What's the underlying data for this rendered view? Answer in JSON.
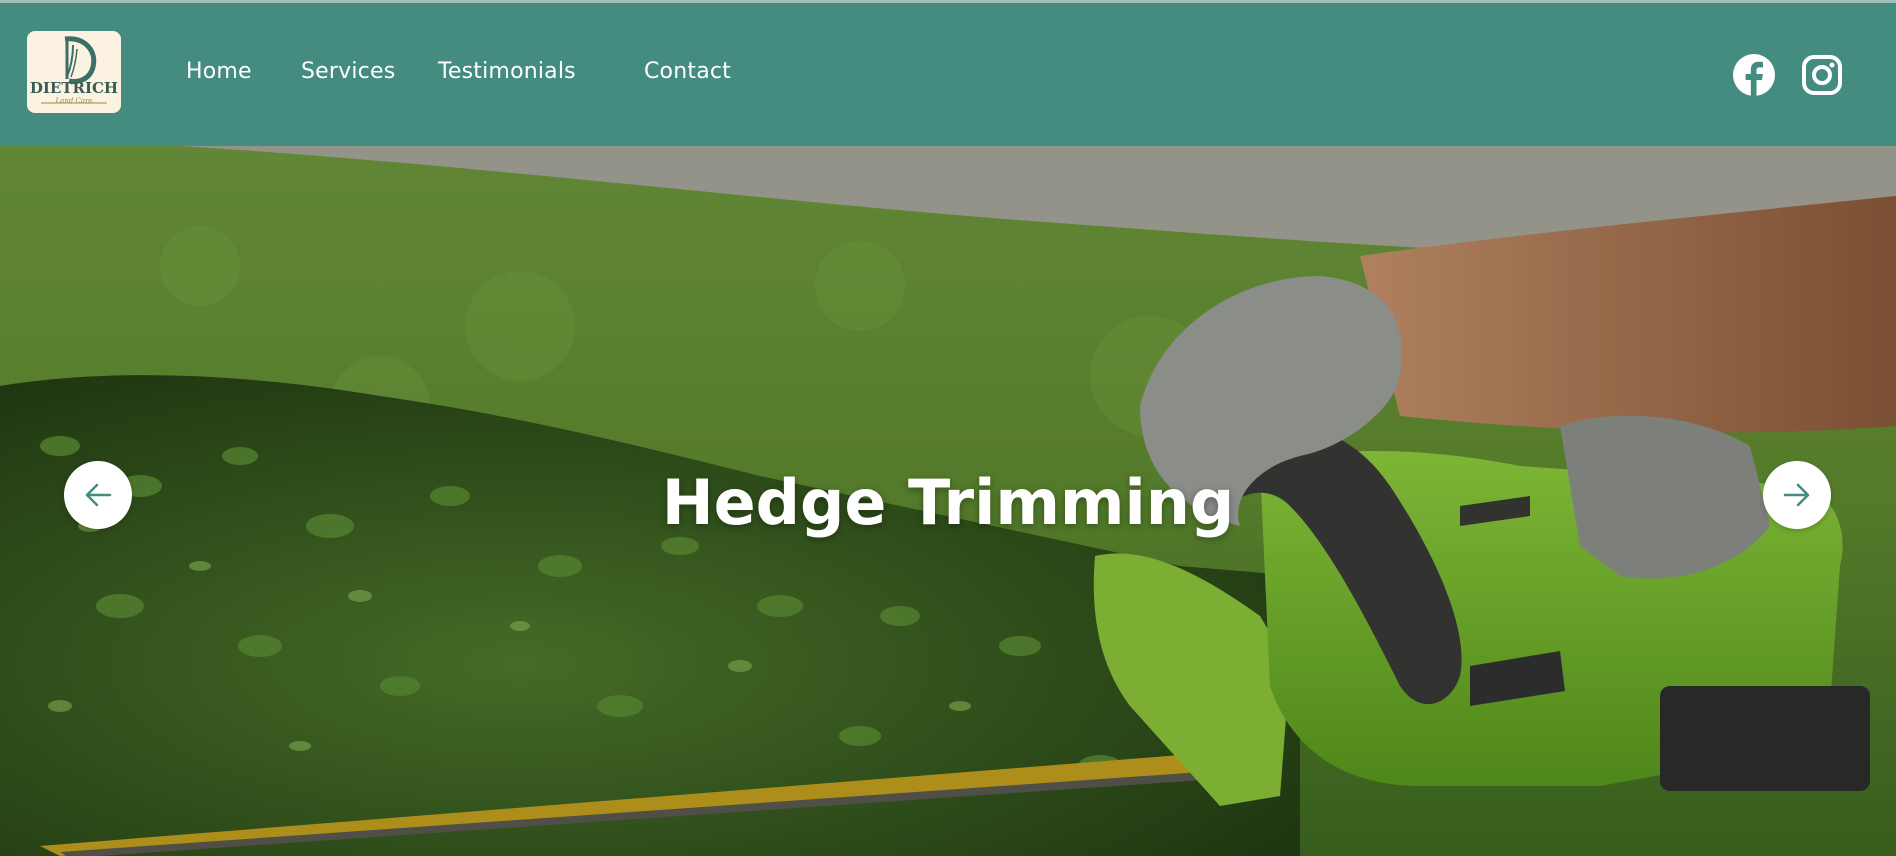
{
  "header": {
    "logo": {
      "name": "DIETRICH",
      "tagline": "Land Care"
    },
    "nav": [
      {
        "label": "Home"
      },
      {
        "label": "Services"
      },
      {
        "label": "Testimonials"
      },
      {
        "label": "Contact"
      }
    ],
    "social": [
      {
        "icon": "facebook-icon"
      },
      {
        "icon": "instagram-icon"
      }
    ],
    "colors": {
      "bar": "#458c80",
      "text": "#ffffff"
    }
  },
  "hero": {
    "title": "Hedge Trimming",
    "prev_icon": "arrow-left-icon",
    "next_icon": "arrow-right-icon"
  }
}
